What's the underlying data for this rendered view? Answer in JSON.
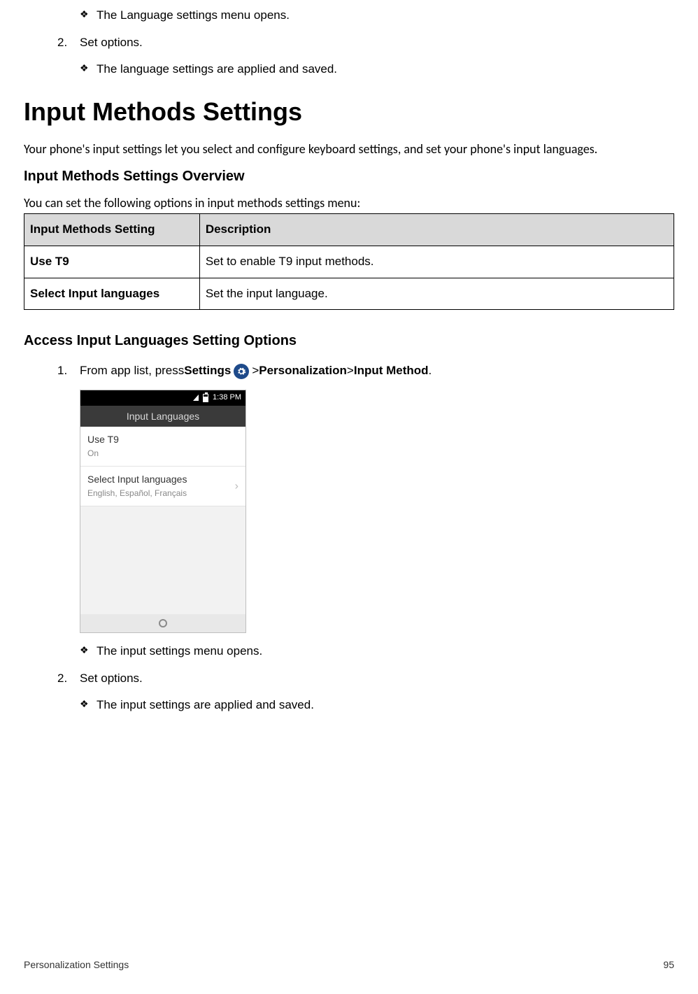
{
  "top": {
    "b1": "The Language settings menu opens.",
    "n2": "2.",
    "n2_text": "Set options.",
    "b2": "The language settings are applied and saved."
  },
  "h1": "Input Methods Settings",
  "intro": "Your phone's input settings let you select and configure keyboard settings, and set your phone's input languages.",
  "h2a": "Input Methods Settings Overview",
  "lead": "You can set the following options in input methods settings menu:",
  "table": {
    "hdr1": "Input Methods Setting",
    "hdr2": "Description",
    "r1c1": "Use T9",
    "r1c2": "Set to enable T9 input methods.",
    "r2c1": "Select Input languages",
    "r2c2": "Set the input language."
  },
  "h2b": "Access Input Languages Setting Options",
  "step1": {
    "num": "1.",
    "pre": "From app list, press ",
    "settings": "Settings",
    "sep1": " > ",
    "personalization": "Personalization",
    "sep2": " > ",
    "inputmethod": "Input Method",
    "dot": "."
  },
  "phone": {
    "time": "1:38 PM",
    "title": "Input Languages",
    "row1_t": "Use T9",
    "row1_s": "On",
    "row2_t": "Select Input languages",
    "row2_s": "English, Español, Français",
    "chev": "›"
  },
  "after": {
    "b1": "The input settings menu opens.",
    "n2": "2.",
    "n2_text": "Set options.",
    "b2": "The input settings are applied and saved."
  },
  "footer": {
    "left": "Personalization Settings",
    "right": "95"
  },
  "sym": "❖"
}
